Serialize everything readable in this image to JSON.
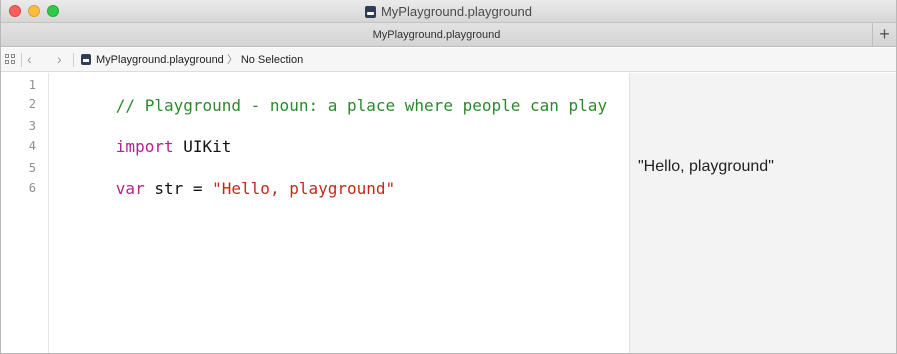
{
  "window": {
    "title": "MyPlayground.playground",
    "file_icon": "playground-file-icon"
  },
  "tabbar": {
    "tab_label": "MyPlayground.playground",
    "add_label": "+"
  },
  "jumpbar": {
    "back": "‹",
    "forward": "›",
    "file": "MyPlayground.playground",
    "chevron": "〉",
    "selection": "No Selection"
  },
  "editor": {
    "line_numbers": [
      "1",
      "2",
      "3",
      "4",
      "5",
      "6"
    ],
    "lines": {
      "l1_comment": "// Playground - noun: a place where people can play",
      "l3_kw": "import",
      "l3_rest": " UIKit",
      "l5_kw": "var",
      "l5_mid": " str = ",
      "l5_str": "\"Hello, playground\""
    }
  },
  "results": {
    "line5": "\"Hello, playground\""
  },
  "colors": {
    "comment": "#2a8a2c",
    "keyword": "#b5238c",
    "string": "#c4281c"
  }
}
